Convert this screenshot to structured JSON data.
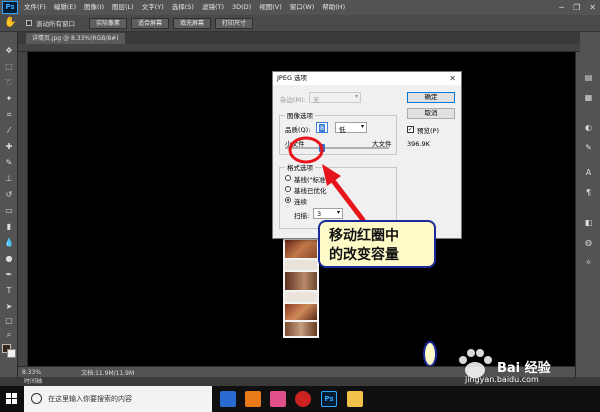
{
  "app": {
    "logo": "Ps"
  },
  "menu": [
    "文件(F)",
    "编辑(E)",
    "图像(I)",
    "图层(L)",
    "文字(Y)",
    "选择(S)",
    "滤镜(T)",
    "3D(D)",
    "视图(V)",
    "窗口(W)",
    "帮助(H)"
  ],
  "window_controls": {
    "minimize": "─",
    "restore": "❐",
    "close": "✕"
  },
  "options_bar": {
    "scroll_all_label": "滚动所有窗口",
    "btn_actual": "100%",
    "btn_fit": "适合屏幕",
    "btn_fill": "填充屏幕",
    "btn_print": "打印尺寸",
    "btn_mid": "实际像素"
  },
  "document_tab": "详情页.jpg @ 8.33%(RGB/8#)",
  "dialog": {
    "title": "JPEG 选项",
    "close": "✕",
    "matte_label": "杂边(M):",
    "matte_value": "无",
    "image_options_label": "图像选项",
    "quality_label": "品质(Q):",
    "quality_value": "8",
    "quality_level": "低",
    "small_file": "小文件",
    "large_file": "大文件",
    "format_options_label": "格式选项",
    "format_baseline": "基线(\"标准\")",
    "format_optimized": "基线已优化",
    "format_progressive": "连续",
    "scans_label": "扫描:",
    "scans_value": "3",
    "ok": "确定",
    "cancel": "取消",
    "preview_label": "预览(P)",
    "file_size": "396.9K",
    "quality_fraction": 0.67
  },
  "callout": {
    "line1": "移动红圈中",
    "line2": "的改变容量"
  },
  "status": {
    "zoom": "8.33%",
    "doc": "文档:11.9M/11.9M"
  },
  "timeline_tab": "时间轴",
  "taskbar": {
    "search_placeholder": "在这里输入你要搜索的内容"
  },
  "watermark": {
    "main": "Bai 经验",
    "sub": "jingyan.baidu.com"
  },
  "colors": {
    "accent": "#31a8ff",
    "annotation_red": "#e8141b",
    "callout_border": "#1a2a9a",
    "callout_bg": "#fffbc8"
  },
  "icons": [
    "hand-icon",
    "move-icon",
    "marquee-icon",
    "lasso-icon",
    "magic-wand-icon",
    "crop-icon",
    "eyedropper-icon",
    "brush-icon",
    "stamp-icon",
    "eraser-icon",
    "gradient-icon",
    "pen-icon",
    "text-icon",
    "path-select-icon",
    "shape-icon",
    "zoom-icon",
    "search-icon",
    "windows-start-icon"
  ]
}
